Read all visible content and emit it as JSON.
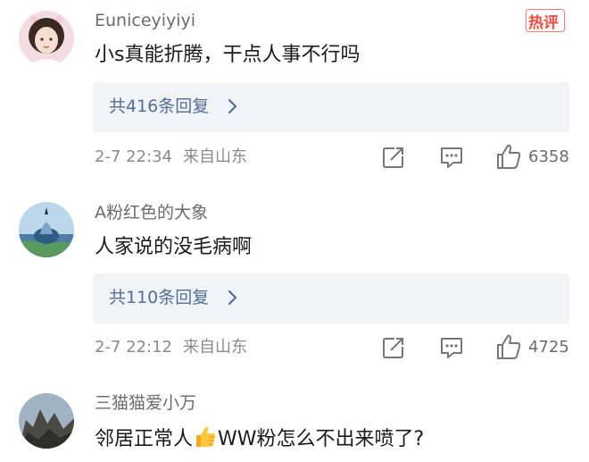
{
  "hot_badge": "热评",
  "comments": [
    {
      "username": "Euniceyiyiyi",
      "text": "小s真能折腾，干点人事不行吗",
      "replies": "共416条回复",
      "time": "2-7 22:34",
      "location": "来自山东",
      "likes": "6358"
    },
    {
      "username": "A粉红色的大象",
      "text": "人家说的没毛病啊",
      "replies": "共110条回复",
      "time": "2-7 22:12",
      "location": "来自山东",
      "likes": "4725"
    },
    {
      "username": "三猫猫爱小万",
      "text_before_emoji": "邻居正常人",
      "text_after_emoji": "WW粉怎么不出来喷了?"
    }
  ]
}
